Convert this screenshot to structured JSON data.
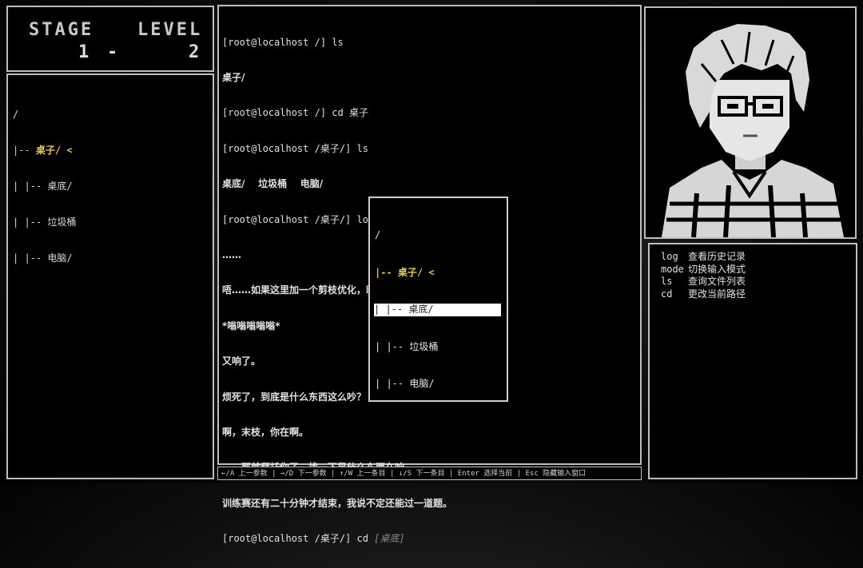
{
  "stage": {
    "stage_label": "STAGE",
    "level_label": "LEVEL",
    "stage_value": "1",
    "dash": "-",
    "level_value": "2"
  },
  "tree": {
    "root": "/",
    "lines": [
      {
        "prefix": "|-- ",
        "name": "桌子/ <",
        "highlight": true
      },
      {
        "prefix": "| |-- ",
        "name": "桌底/",
        "highlight": false
      },
      {
        "prefix": "| |-- ",
        "name": "垃圾桶",
        "highlight": false
      },
      {
        "prefix": "| |-- ",
        "name": "电脑/",
        "highlight": false
      }
    ]
  },
  "terminal": {
    "lines": [
      "[root@localhost /] ls",
      "桌子/",
      "[root@localhost /] cd 桌子",
      "[root@localhost /桌子/] ls",
      "桌底/    垃圾桶    电脑/",
      "[root@localhost /桌子/] log",
      "……",
      "唔……如果这里加一个剪枝优化，时间复杂度应该能降下来……",
      "*嗡嗡嗡嗡嗡*",
      "又响了。",
      "烦死了，到底是什么东西这么吵？",
      "啊，末枝，你在啊。",
      "……那就拜托你了，找一下是什么东西在响。",
      "训练赛还有二十分钟才结束，我说不定还能过一道题。"
    ],
    "prompt": "[root@localhost /桌子/] cd ",
    "suggestion": "[桌底]"
  },
  "popup": {
    "root": "/",
    "items": [
      {
        "text": "|-- 桌子/ <",
        "style": "highlight"
      },
      {
        "text": "| |-- 桌底/",
        "style": "selected"
      },
      {
        "text": "| |-- 垃圾桶",
        "style": "normal"
      },
      {
        "text": "| |-- 电脑/",
        "style": "normal"
      }
    ]
  },
  "commands": [
    {
      "key": "log",
      "desc": "查看历史记录"
    },
    {
      "key": "mode",
      "desc": "切换输入模式"
    },
    {
      "key": "ls",
      "desc": "查询文件列表"
    },
    {
      "key": "cd",
      "desc": "更改当前路径"
    }
  ],
  "help_bar": "←/A 上一参数 | →/D 下一参数 | ↑/W 上一条目 | ↓/S 下一条目 | Enter 选择当前 | Esc 隐藏输入窗口",
  "portrait": {
    "icon": "pixel-character-portrait"
  },
  "colors": {
    "highlight": "#e6c84a",
    "border": "#bdbdbd",
    "background": "#000000"
  }
}
